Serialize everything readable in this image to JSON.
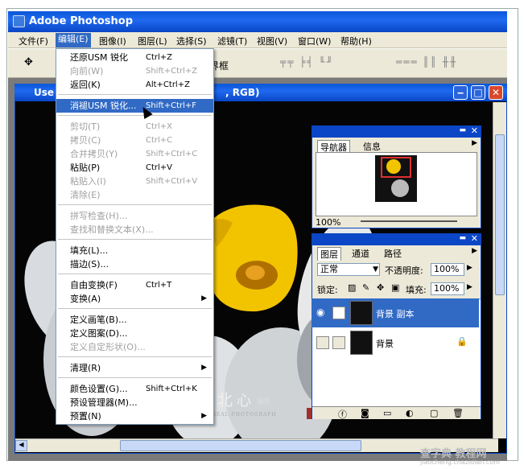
{
  "app": {
    "title": "Adobe Photoshop"
  },
  "menubar": {
    "items": [
      "文件(F)",
      "编辑(E)",
      "图像(I)",
      "图层(L)",
      "选择(S)",
      "滤镜(T)",
      "视图(V)",
      "窗口(W)",
      "帮助(H)"
    ]
  },
  "toolbar": {
    "label": "界框"
  },
  "document": {
    "title_left": "Use",
    "title_right": ", RGB)"
  },
  "edit_menu": {
    "items": [
      {
        "label": "还原USM 锐化",
        "shortcut": "Ctrl+Z",
        "state": "normal"
      },
      {
        "label": "向前(W)",
        "shortcut": "Shift+Ctrl+Z",
        "state": "disabled"
      },
      {
        "label": "返回(K)",
        "shortcut": "Alt+Ctrl+Z",
        "state": "normal"
      },
      {
        "label": "消褪USM 锐化...",
        "shortcut": "Shift+Ctrl+F",
        "state": "highlighted"
      },
      {
        "label": "剪切(T)",
        "shortcut": "Ctrl+X",
        "state": "disabled"
      },
      {
        "label": "拷贝(C)",
        "shortcut": "Ctrl+C",
        "state": "disabled"
      },
      {
        "label": "合并拷贝(Y)",
        "shortcut": "Shift+Ctrl+C",
        "state": "disabled"
      },
      {
        "label": "粘贴(P)",
        "shortcut": "Ctrl+V",
        "state": "normal"
      },
      {
        "label": "粘贴入(I)",
        "shortcut": "Shift+Ctrl+V",
        "state": "disabled"
      },
      {
        "label": "清除(E)",
        "shortcut": "",
        "state": "disabled"
      },
      {
        "label": "拼写检查(H)...",
        "shortcut": "",
        "state": "disabled"
      },
      {
        "label": "查找和替换文本(X)...",
        "shortcut": "",
        "state": "disabled"
      },
      {
        "label": "填充(L)...",
        "shortcut": "",
        "state": "normal"
      },
      {
        "label": "描边(S)...",
        "shortcut": "",
        "state": "normal"
      },
      {
        "label": "自由变换(F)",
        "shortcut": "Ctrl+T",
        "state": "normal"
      },
      {
        "label": "变换(A)",
        "shortcut": "",
        "state": "submenu"
      },
      {
        "label": "定义画笔(B)...",
        "shortcut": "",
        "state": "normal"
      },
      {
        "label": "定义图案(D)...",
        "shortcut": "",
        "state": "normal"
      },
      {
        "label": "定义自定形状(O)...",
        "shortcut": "",
        "state": "disabled"
      },
      {
        "label": "清理(R)",
        "shortcut": "",
        "state": "submenu"
      },
      {
        "label": "颜色设置(G)...",
        "shortcut": "Shift+Ctrl+K",
        "state": "normal"
      },
      {
        "label": "预设管理器(M)...",
        "shortcut": "",
        "state": "normal"
      },
      {
        "label": "预置(N)",
        "shortcut": "",
        "state": "submenu"
      }
    ]
  },
  "navigator": {
    "tabs": [
      "导航器",
      "信息"
    ],
    "zoom": "100%"
  },
  "layers": {
    "tabs": [
      "图层",
      "通道",
      "路径"
    ],
    "blend_mode": "正常",
    "opacity_label": "不透明度:",
    "opacity_value": "100%",
    "lock_label": "锁定:",
    "fill_label": "填充:",
    "fill_value": "100%",
    "rows": [
      {
        "name": "背景 副本",
        "selected": true
      },
      {
        "name": "背景",
        "selected": false
      }
    ]
  },
  "watermark": {
    "text": "BOREAL-PHOTOGRAPH",
    "site": "查字典 教程网",
    "url": "jiaocheng.chazidian.com"
  },
  "colors": {
    "title_blue": "#0a56d8",
    "menu_highlight": "#316ac5",
    "daffodil_yellow": "#f2c400"
  }
}
